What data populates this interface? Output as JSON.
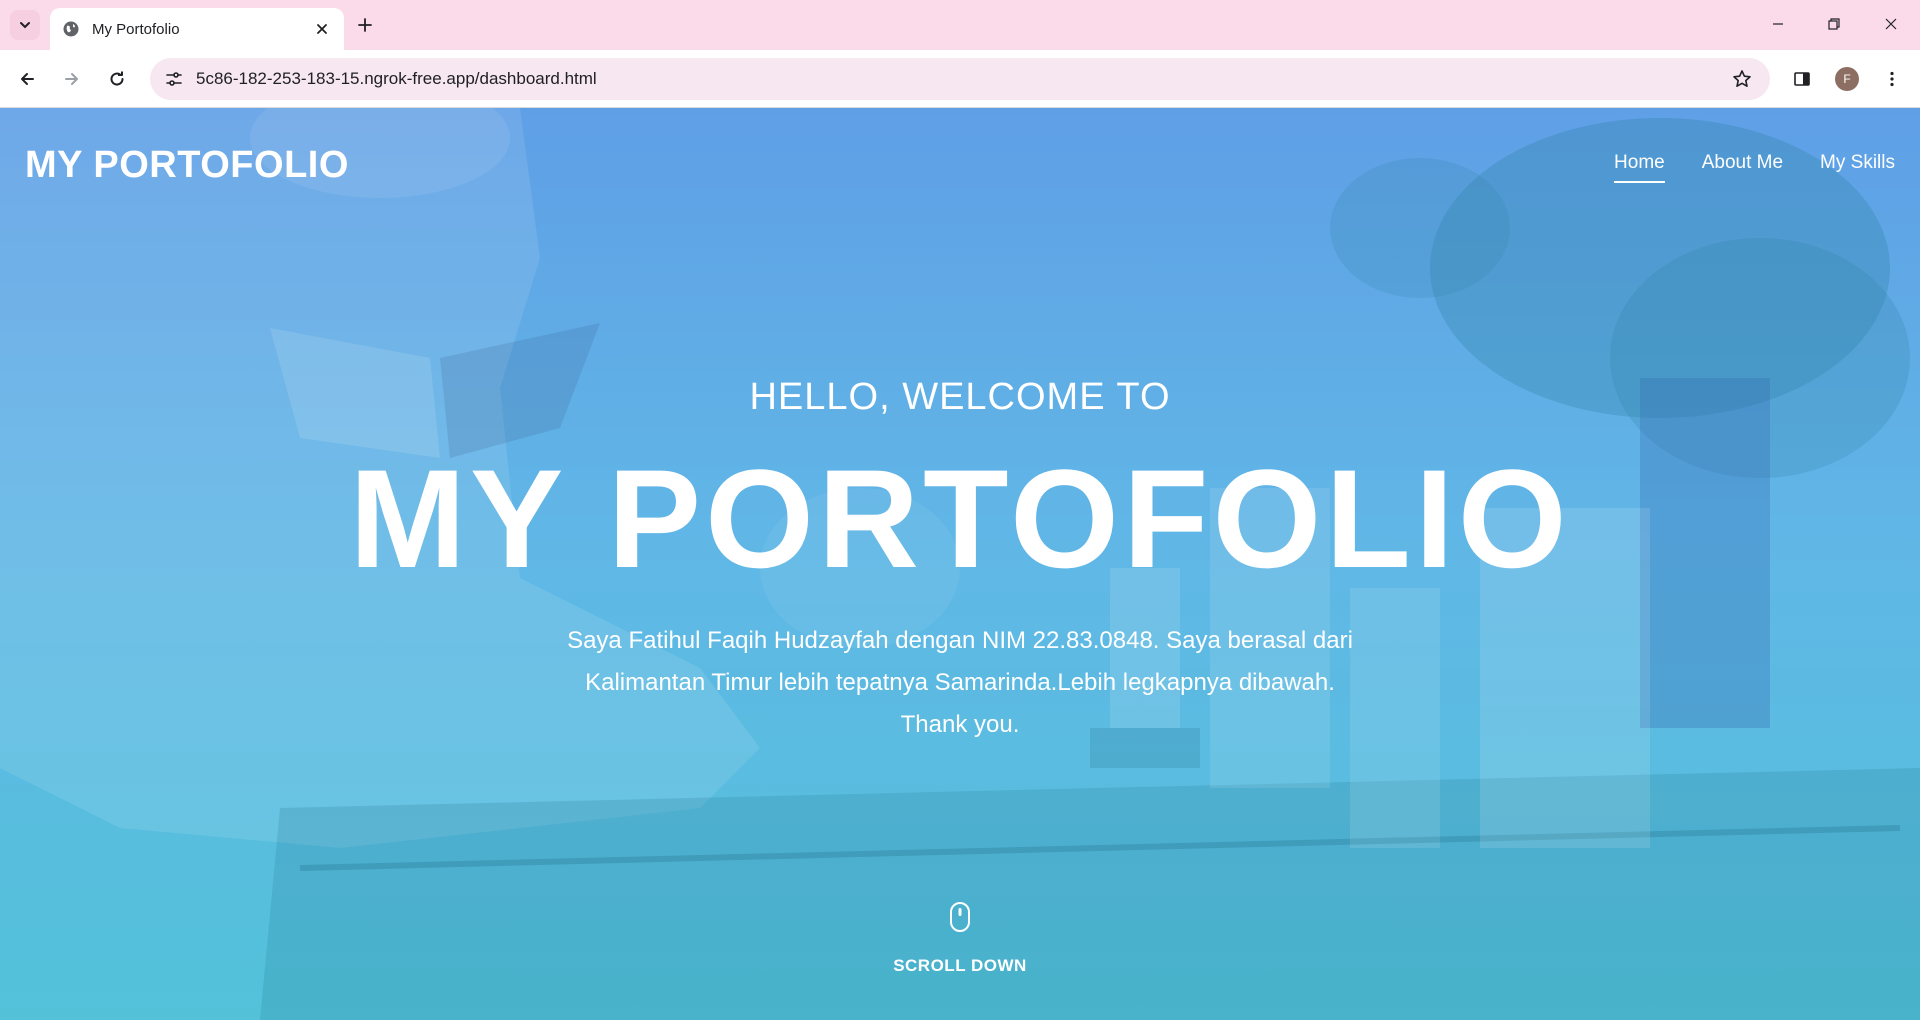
{
  "browser": {
    "tab": {
      "title": "My Portofolio"
    },
    "address_bar": {
      "url": "5c86-182-253-183-15.ngrok-free.app/dashboard.html"
    },
    "profile_initial": "F",
    "icons": {
      "tab_search": "chevron-down-icon",
      "favicon": "globe-icon",
      "close_tab": "close-icon",
      "new_tab": "plus-icon",
      "minimize": "minimize-icon",
      "restore": "restore-icon",
      "close_window": "close-icon",
      "back": "arrow-left-icon",
      "forward": "arrow-right-icon",
      "reload": "reload-icon",
      "site_info": "tune-icon",
      "bookmark": "star-icon",
      "side_panel": "side-panel-icon",
      "menu": "more-vert-icon"
    }
  },
  "page": {
    "brand": "MY PORTOFOLIO",
    "nav": [
      {
        "label": "Home",
        "active": true
      },
      {
        "label": "About Me",
        "active": false
      },
      {
        "label": "My Skills",
        "active": false
      }
    ],
    "hero": {
      "greeting": "HELLO, WELCOME TO",
      "title": "MY PORTOFOLIO",
      "description": "Saya Fatihul Faqih Hudzayfah dengan NIM 22.83.0848. Saya berasal dari Kalimantan Timur lebih tepatnya Samarinda.Lebih legkapnya dibawah. Thank you."
    },
    "scroll": {
      "label": "SCROLL DOWN",
      "icon": "mouse-icon"
    }
  },
  "colors": {
    "tabstrip": "#fbdbe9",
    "omnibox": "#f7e7f0",
    "overlay_top": "#5f9fe6",
    "overlay_bottom": "#53c2d9",
    "text": "#ffffff"
  }
}
